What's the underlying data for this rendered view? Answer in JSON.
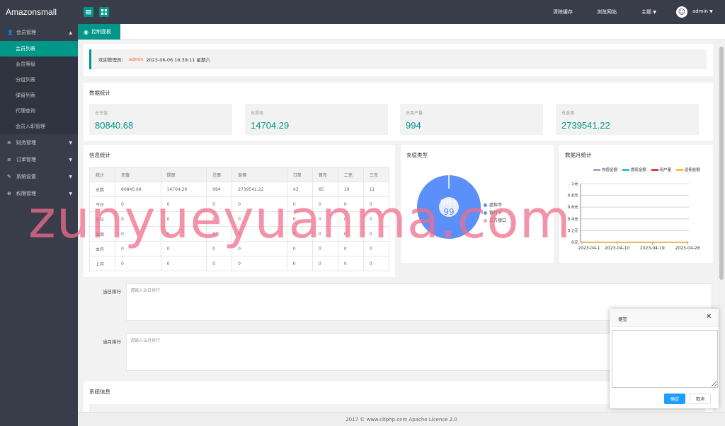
{
  "app": {
    "title": "Amazonsmall"
  },
  "header": {
    "clear_cache": "清除缓存",
    "browse_site": "浏览网站",
    "theme": "主题",
    "user": "admin"
  },
  "sidebar": {
    "groups": [
      {
        "label": "会员管理",
        "icon": "user-icon",
        "expanded": true,
        "items": [
          "会员列表",
          "会员等级",
          "分组列表",
          "弹窗列表",
          "代理查询",
          "会员入职管理"
        ]
      },
      {
        "label": "财务管理",
        "icon": "database-icon"
      },
      {
        "label": "订单管理",
        "icon": "database-icon"
      },
      {
        "label": "系统设置",
        "icon": "wrench-icon"
      },
      {
        "label": "权限管理",
        "icon": "globe-icon"
      }
    ]
  },
  "tabs": {
    "active": "控制面板"
  },
  "welcome": {
    "prefix": "欢迎管理员：",
    "user": "admin",
    "datetime": "2023-06-06  16:39:11  星期六"
  },
  "data_stats": {
    "title": "数据统计",
    "cards": [
      {
        "label": "总充值",
        "value": "80840.68"
      },
      {
        "label": "总提现",
        "value": "14704.29"
      },
      {
        "label": "总用户量",
        "value": "994"
      },
      {
        "label": "总返佣",
        "value": "2739541.22"
      }
    ]
  },
  "info_stats": {
    "title": "信息统计",
    "headers": [
      "统计",
      "充值",
      "提现",
      "注册",
      "返佣",
      "订单",
      "首充",
      "二充",
      "三充"
    ],
    "rows": [
      [
        "总数",
        "80840.68",
        "14704.29",
        "994",
        "2739541.22",
        "43",
        "65",
        "19",
        "11"
      ],
      [
        "今日",
        "0",
        "0",
        "0",
        "0",
        "0",
        "0",
        "0",
        "0"
      ],
      [
        "昨日",
        "0",
        "0",
        "0",
        "0",
        "0",
        "0",
        "0",
        "0"
      ],
      [
        "本周",
        "0",
        "0",
        "0",
        "0",
        "0",
        "0",
        "0",
        "0"
      ],
      [
        "本月",
        "0",
        "0",
        "0",
        "0",
        "0",
        "0",
        "0",
        "0"
      ],
      [
        "上月",
        "0",
        "0",
        "0",
        "0",
        "0",
        "0",
        "0",
        "0"
      ]
    ]
  },
  "recharge_type": {
    "title": "充值类型",
    "center_label": "银行卡",
    "center_value": "99",
    "legend": [
      "虚拟币",
      "银行卡",
      "三方接口"
    ],
    "colors": [
      "#5b8ff9",
      "#5b8ff9",
      "#f6a5b6"
    ]
  },
  "monthly_stats": {
    "title": "数据月统计",
    "legend": [
      "充值金额",
      "提现金额",
      "用户量",
      "返佣金额"
    ],
    "legend_colors": [
      "#b39ddb",
      "#26c6da",
      "#e53935",
      "#fbc02d"
    ]
  },
  "chart_data": {
    "type": "line",
    "x": [
      "2023-04-1",
      "2023-04-10",
      "2023-04-19",
      "2023-04-28"
    ],
    "y_ticks": [
      "0元",
      "0.2元",
      "0.4元",
      "0.6元",
      "0.8元",
      "1元"
    ],
    "ylim": [
      0,
      1
    ],
    "series": [
      {
        "name": "充值金额",
        "values": [
          0,
          0,
          0,
          0
        ]
      },
      {
        "name": "提现金额",
        "values": [
          0,
          0,
          0,
          0
        ]
      },
      {
        "name": "用户量",
        "values": [
          0,
          0,
          0,
          0
        ]
      },
      {
        "name": "返佣金额",
        "values": [
          0,
          0,
          0,
          0
        ]
      }
    ]
  },
  "ranking": {
    "daily_label": "当日排行",
    "daily_placeholder": "请输入当日排行",
    "monthly_label": "当月排行",
    "monthly_placeholder": "请输入当月排行"
  },
  "system_info": {
    "title": "系统信息"
  },
  "footer": {
    "text": "2017 ©  www.cltphp.com  Apache Licence 2.0"
  },
  "dialog": {
    "title": "便签",
    "ok": "确定",
    "cancel": "取消"
  },
  "watermark": "zunyueyuanma.com"
}
